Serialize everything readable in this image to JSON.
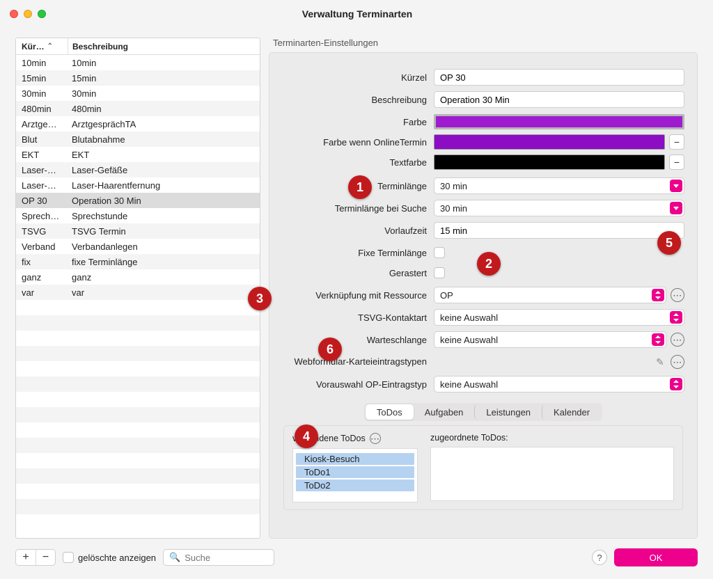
{
  "window": {
    "title": "Verwaltung Terminarten"
  },
  "table": {
    "headers": {
      "col1": "Kür…",
      "col2": "Beschreibung"
    },
    "rows": [
      {
        "k": "10min",
        "b": "10min"
      },
      {
        "k": "15min",
        "b": "15min"
      },
      {
        "k": "30min",
        "b": "30min"
      },
      {
        "k": "480min",
        "b": "480min"
      },
      {
        "k": "Arztge…",
        "b": "ArztgesprächTA"
      },
      {
        "k": "Blut",
        "b": "Blutabnahme"
      },
      {
        "k": "EKT",
        "b": "EKT"
      },
      {
        "k": "Laser-…",
        "b": "Laser-Gefäße"
      },
      {
        "k": "Laser-…",
        "b": "Laser-Haarentfernung"
      },
      {
        "k": "OP 30",
        "b": "Operation 30 Min",
        "selected": true
      },
      {
        "k": "Sprech…",
        "b": "Sprechstunde"
      },
      {
        "k": "TSVG",
        "b": "TSVG Termin"
      },
      {
        "k": "Verband",
        "b": "Verbandanlegen"
      },
      {
        "k": "fix",
        "b": "fixe Terminlänge"
      },
      {
        "k": "ganz",
        "b": "ganz"
      },
      {
        "k": "var",
        "b": "var"
      }
    ]
  },
  "settings": {
    "title": "Terminarten-Einstellungen",
    "labels": {
      "kuerzel": "Kürzel",
      "beschreibung": "Beschreibung",
      "farbe": "Farbe",
      "farbe_online": "Farbe wenn OnlineTermin",
      "textfarbe": "Textfarbe",
      "terminlaenge": "Terminlänge",
      "terminlaenge_suche": "Terminlänge bei Suche",
      "vorlaufzeit": "Vorlaufzeit",
      "fixe_laenge": "Fixe Terminlänge",
      "gerastert": "Gerastert",
      "ressource": "Verknüpfung mit Ressource",
      "tsvg": "TSVG-Kontaktart",
      "warteschlange": "Warteschlange",
      "webform": "Webformular-Karteieintragstypen",
      "vorauswahl_op": "Vorauswahl OP-Eintragstyp"
    },
    "values": {
      "kuerzel": "OP 30",
      "beschreibung": "Operation 30 Min",
      "terminlaenge": "30 min",
      "terminlaenge_suche": "30 min",
      "vorlaufzeit": "15 min",
      "ressource": "OP",
      "tsvg": "keine Auswahl",
      "warteschlange": "keine Auswahl",
      "vorauswahl_op": "keine Auswahl"
    },
    "colors": {
      "farbe": "#9e1bd0",
      "farbe_online": "#8c0dc3",
      "textfarbe": "#000000"
    }
  },
  "tabs": {
    "items": [
      "ToDos",
      "Aufgaben",
      "Leistungen",
      "Kalender"
    ],
    "active": 0,
    "available_title": "vorhandene ToDos",
    "assigned_title": "zugeordnete ToDos:",
    "available": [
      "Kiosk-Besuch",
      "ToDo1",
      "ToDo2"
    ]
  },
  "footer": {
    "show_deleted": "gelöschte anzeigen",
    "search_placeholder": "Suche",
    "ok": "OK"
  },
  "badges": {
    "1": "1",
    "2": "2",
    "3": "3",
    "4": "4",
    "5": "5",
    "6": "6"
  }
}
